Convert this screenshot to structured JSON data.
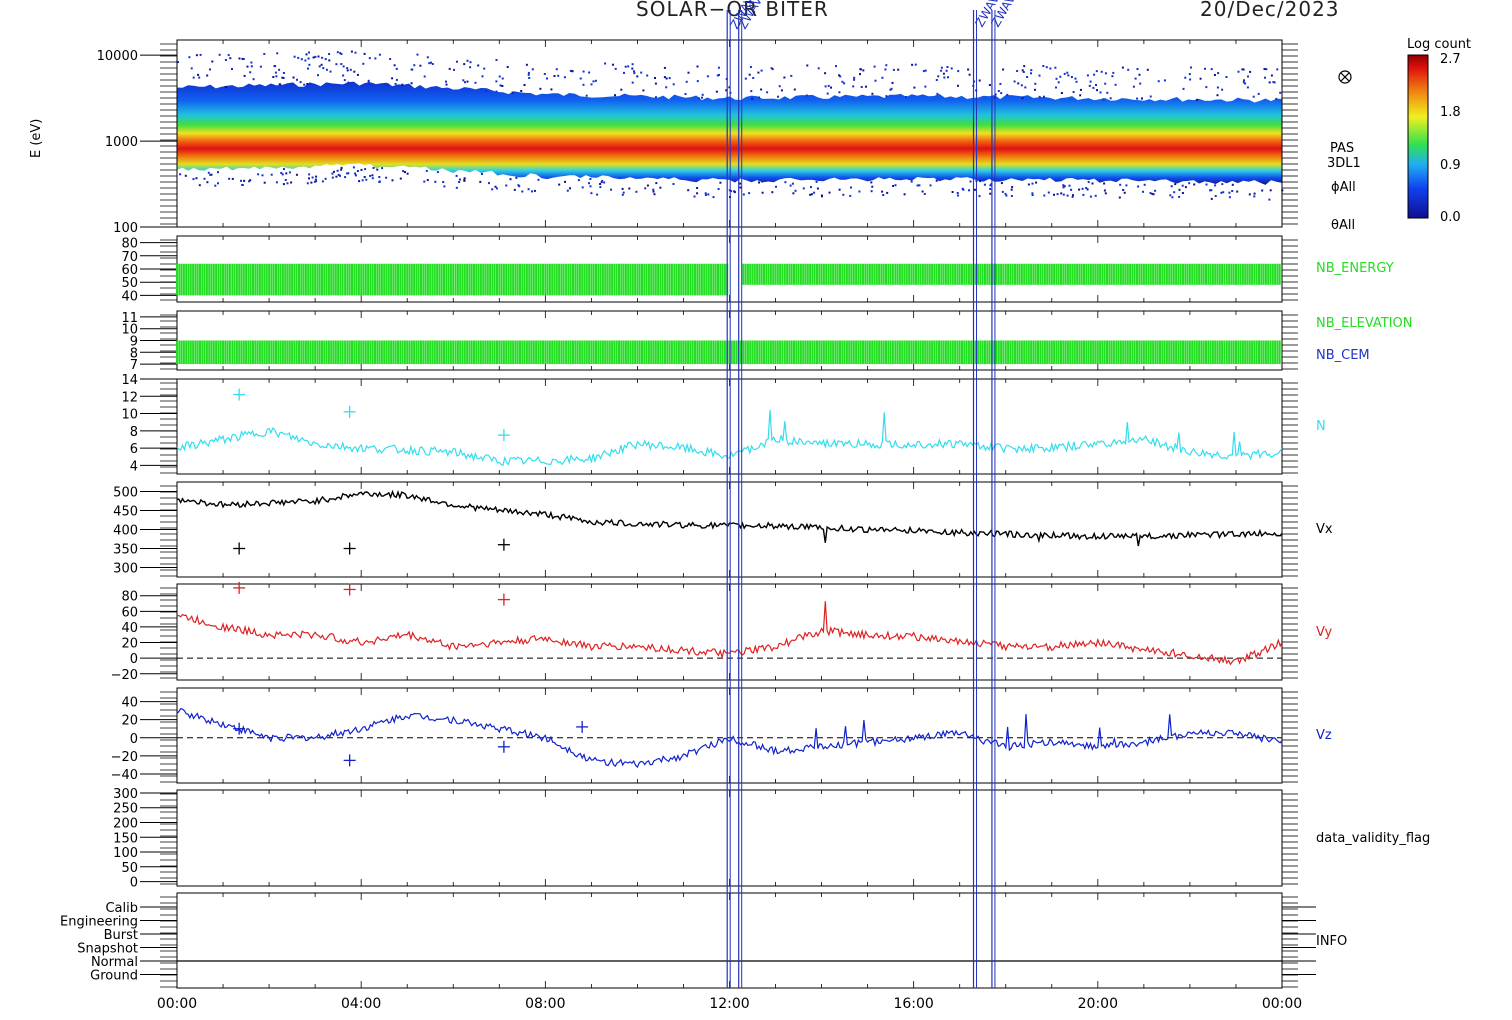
{
  "header": {
    "mission": "SOLAR−OR BITER",
    "date": "20/Dec/2023",
    "event_labels": [
      "ZWAVE",
      "ZWAVE",
      "ZWAVE",
      "ZWAVE"
    ]
  },
  "colorbar": {
    "title": "Log count",
    "ticks": [
      "2.7",
      "1.8",
      "0.9",
      "0.0"
    ]
  },
  "side_labels": {
    "spectrogram": [
      "PAS",
      "3DL1",
      "ϕAll",
      "θAll"
    ],
    "nb": [
      "NB_ENERGY",
      "NB_ELEVATION",
      "NB_CEM"
    ],
    "n": "N",
    "vx": "Vx",
    "vy": "Vy",
    "vz": "Vz",
    "validity": "data_validity_flag",
    "info": "INFO"
  },
  "colors": {
    "nb_energy": "#22dd22",
    "nb_cem": "#2233cc",
    "n": "#33ddee",
    "vx": "#000000",
    "vy": "#dd2222",
    "vz": "#1122cc",
    "event_lines": "#2233bb"
  },
  "chart_data": [
    {
      "type": "heatmap",
      "panel": "spectrogram",
      "ylabel": "E (eV)",
      "ytick_labels": [
        "10000",
        "1000",
        "100"
      ],
      "ylim": [
        100,
        15000
      ],
      "yscale": "log",
      "peak_energy_eV": {
        "x_hours": [
          0,
          4,
          8,
          12,
          16,
          20,
          24
        ],
        "values": [
          1200,
          1350,
          1000,
          900,
          950,
          900,
          850
        ]
      },
      "colorscale_log_count": [
        0.0,
        2.7
      ]
    },
    {
      "type": "bar",
      "panel": "nb_energy",
      "ytick_labels": [
        "80",
        "70",
        "60",
        "50",
        "40"
      ],
      "ylim": [
        35,
        85
      ],
      "segments": [
        {
          "x_hours": [
            0,
            12
          ],
          "range": [
            40,
            64
          ]
        },
        {
          "x_hours": [
            12.3,
            24
          ],
          "range": [
            48,
            64
          ]
        }
      ]
    },
    {
      "type": "bar",
      "panel": "nb_elevation",
      "ytick_labels": [
        "11",
        "10",
        "9",
        "8",
        "7"
      ],
      "ylim": [
        6.5,
        11.5
      ],
      "segments": [
        {
          "x_hours": [
            0,
            24
          ],
          "range": [
            7,
            9
          ]
        }
      ]
    },
    {
      "type": "line",
      "panel": "n",
      "ytick_labels": [
        "14",
        "12",
        "10",
        "8",
        "6",
        "4"
      ],
      "ylim": [
        3,
        14
      ],
      "x_hours": [
        0,
        1,
        2,
        3,
        4,
        5,
        6,
        7,
        8,
        9,
        10,
        11,
        12,
        13,
        14,
        15,
        16,
        17,
        18,
        19,
        20,
        21,
        22,
        23,
        24
      ],
      "values": [
        6,
        7,
        8,
        6.5,
        6,
        5.8,
        5.5,
        4.5,
        4.5,
        4.8,
        6.5,
        6,
        5,
        7,
        6.5,
        6.5,
        6.5,
        6.5,
        6,
        6,
        6.5,
        7,
        5.5,
        5,
        5.5
      ],
      "outliers": [
        [
          1.35,
          12.2
        ],
        [
          3.75,
          10.2
        ],
        [
          7.1,
          7.5
        ]
      ]
    },
    {
      "type": "line",
      "panel": "vx",
      "ytick_labels": [
        "500",
        "450",
        "400",
        "350",
        "300"
      ],
      "ylim": [
        275,
        525
      ],
      "x_hours": [
        0,
        1,
        2,
        3,
        4,
        5,
        6,
        7,
        8,
        9,
        10,
        11,
        12,
        13,
        14,
        15,
        16,
        17,
        18,
        19,
        20,
        21,
        22,
        23,
        24
      ],
      "values": [
        480,
        465,
        470,
        475,
        495,
        490,
        465,
        450,
        440,
        420,
        415,
        412,
        410,
        410,
        405,
        400,
        398,
        392,
        388,
        385,
        382,
        382,
        385,
        388,
        390
      ],
      "outliers": [
        [
          1.35,
          350
        ],
        [
          3.75,
          350
        ],
        [
          7.1,
          360
        ]
      ]
    },
    {
      "type": "line",
      "panel": "vy",
      "ytick_labels": [
        "80",
        "60",
        "40",
        "20",
        "0",
        "−20"
      ],
      "ylim": [
        -28,
        95
      ],
      "x_hours": [
        0,
        1,
        2,
        3,
        4,
        5,
        6,
        7,
        8,
        9,
        10,
        11,
        12,
        13,
        14,
        15,
        16,
        17,
        18,
        19,
        20,
        21,
        22,
        23,
        24
      ],
      "values": [
        55,
        40,
        30,
        30,
        20,
        30,
        15,
        20,
        25,
        15,
        15,
        10,
        5,
        15,
        35,
        30,
        28,
        22,
        15,
        15,
        20,
        10,
        5,
        -5,
        20
      ],
      "outliers": [
        [
          1.35,
          90
        ],
        [
          3.75,
          88
        ],
        [
          7.1,
          75
        ]
      ]
    },
    {
      "type": "line",
      "panel": "vz",
      "ytick_labels": [
        "40",
        "20",
        "0",
        "−20",
        "−40"
      ],
      "ylim": [
        -50,
        55
      ],
      "x_hours": [
        0,
        1,
        2,
        3,
        4,
        5,
        6,
        7,
        8,
        9,
        10,
        11,
        12,
        13,
        14,
        15,
        16,
        17,
        18,
        19,
        20,
        21,
        22,
        23,
        24
      ],
      "values": [
        30,
        15,
        0,
        0,
        10,
        25,
        20,
        10,
        0,
        -25,
        -30,
        -20,
        0,
        -15,
        -10,
        -5,
        0,
        5,
        -10,
        -5,
        -10,
        -5,
        5,
        5,
        -5
      ],
      "outliers": [
        [
          1.35,
          10
        ],
        [
          3.75,
          -25
        ],
        [
          7.1,
          -10
        ],
        [
          8.8,
          12
        ]
      ]
    },
    {
      "type": "line",
      "panel": "data_validity_flag",
      "ytick_labels": [
        "300",
        "250",
        "200",
        "150",
        "100",
        "50",
        "0"
      ],
      "ylim": [
        -15,
        310
      ]
    },
    {
      "type": "line",
      "panel": "info",
      "ytick_labels": [
        "Calib",
        "Engineering",
        "Burst",
        "Snapshot",
        "Normal",
        "Ground"
      ],
      "mode_by_hour": "Normal"
    }
  ],
  "xaxis": {
    "tick_labels": [
      "00:00",
      "04:00",
      "08:00",
      "12:00",
      "16:00",
      "20:00",
      "00:00"
    ],
    "xlim_hours": [
      0,
      24
    ],
    "event_times_hours": [
      11.95,
      12.2,
      17.3,
      17.7
    ]
  }
}
